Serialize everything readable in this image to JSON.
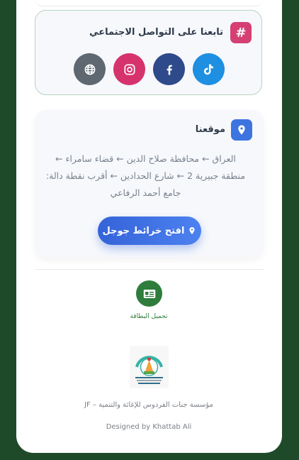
{
  "social": {
    "title": "تابعنا على التواصل الاجتماعي",
    "badge_symbol": "#",
    "links": [
      {
        "name": "tiktok",
        "icon": "tiktok-icon",
        "color": "#1e8fe1"
      },
      {
        "name": "facebook",
        "icon": "facebook-icon",
        "color": "#2f4a8a"
      },
      {
        "name": "instagram",
        "icon": "instagram-icon",
        "color": "#d6336c"
      },
      {
        "name": "website",
        "icon": "globe-icon",
        "color": "#5f6770"
      }
    ]
  },
  "location": {
    "title": "موقعنا",
    "address_lines": [
      "العراق ← محافظة صلاح الدين ← قضاء سامراء ←",
      "منطقة جبيرية 2 ← شارع الحدادين ← أقرب نقطة دالة:",
      "جامع أحمد الرفاعي"
    ],
    "maps_button": "افتح خرائط جوجل"
  },
  "card_download": {
    "label": "تحميل البطاقة"
  },
  "footer": {
    "org_name": "مؤسسة جنات الفردوس للإغاثة والتنمية – JF",
    "credit": "Designed by Khattab Ali"
  },
  "colors": {
    "background": "#1f4a2a",
    "accent_green": "#2e7d3c",
    "accent_blue": "#3d74e0",
    "accent_pink": "#d53f72"
  }
}
